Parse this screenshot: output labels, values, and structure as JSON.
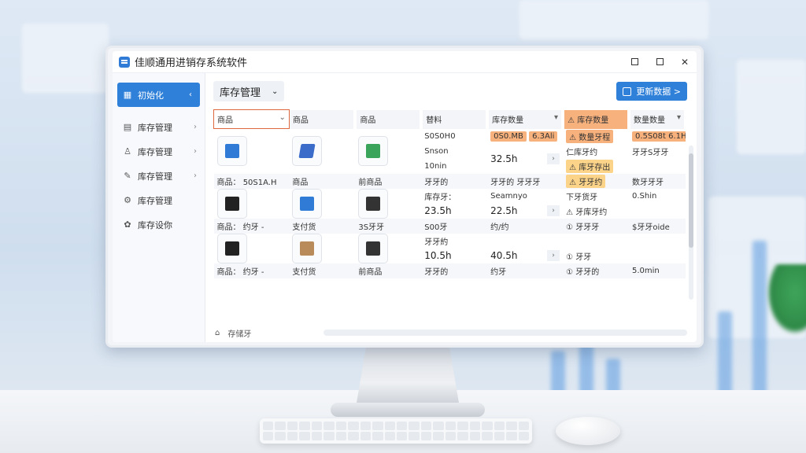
{
  "window": {
    "title": "佳顺通用进销存系统软件"
  },
  "sidebar": {
    "items": [
      {
        "label": "初始化",
        "icon": "grid-icon",
        "active": true
      },
      {
        "label": "库存管理",
        "icon": "document-icon"
      },
      {
        "label": "库存管理",
        "icon": "user-icon"
      },
      {
        "label": "库存管理",
        "icon": "edit-icon"
      },
      {
        "label": "库存管理",
        "icon": "gear-icon"
      },
      {
        "label": "库存设你",
        "icon": "settings-icon"
      }
    ]
  },
  "main": {
    "title": "库存管理",
    "action_button": "更新数据 >"
  },
  "table": {
    "headers": [
      "商品",
      "商品",
      "商品",
      "替料",
      "库存数量",
      "库存数量",
      "数量数量"
    ],
    "rows": [
      {
        "c0_caption": "商品：",
        "c0_code": "50S1A.H",
        "c1_caption": "商品",
        "c2_caption": "前商品",
        "c3_lines": [
          "S0S0H0",
          "Snson",
          "10nin"
        ],
        "c3_caption": "牙牙的",
        "c4_top": "0S0.MB",
        "c4_top2": "6.3Ali",
        "c4_mid": "32.5h",
        "c4_caption": "牙牙的 牙牙牙",
        "c5_top": "⚠ 数量牙程",
        "c5_lines": [
          "仁库牙约",
          "⚠ 库牙存出",
          "⚠ 牙牙约"
        ],
        "c6_top": "0.5S08t 6.1H",
        "c6_lines": [
          "牙牙S牙牙",
          "数牙牙牙"
        ]
      },
      {
        "c0_caption": "商品： 约牙 -",
        "c1_caption": "支付货",
        "c2_caption": "3S牙牙",
        "c3_top": "库存牙：",
        "c3_mid": "23.5h",
        "c3_caption": "S00牙",
        "c4_top": "Seamnyo",
        "c4_mid": "22.5h",
        "c4_caption": "约/约",
        "c5_top": "下牙货牙",
        "c5_mid": "⚠ 牙库牙约",
        "c5_caption": "① 牙牙牙",
        "c6_top": "0.Shin",
        "c6_caption": "$牙牙oide"
      },
      {
        "c0_caption": "商品： 约牙 -",
        "c1_caption": "支付货",
        "c2_caption": "前商品",
        "c3_top": "牙牙約",
        "c3_mid": "10.5h",
        "c3_caption": "牙牙的",
        "c4_mid": "40.5h",
        "c4_caption": "约牙",
        "c5_mid": "① 牙牙",
        "c5_caption": "① 牙牙的",
        "c6_caption": "5.0min"
      }
    ]
  },
  "footer": {
    "label": "存储牙"
  },
  "colors": {
    "accent": "#2f80d9",
    "warn": "#fbd48a",
    "orange": "#f7b17d"
  }
}
